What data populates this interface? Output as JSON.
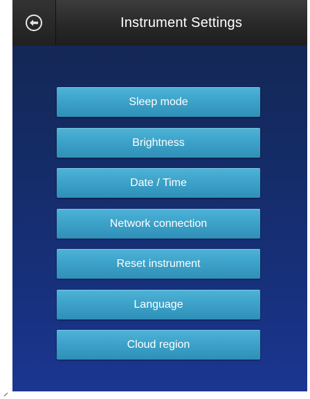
{
  "header": {
    "title": "Instrument Settings",
    "back_icon": "circle-arrow-left-icon"
  },
  "menu": {
    "items": [
      {
        "label": "Sleep mode"
      },
      {
        "label": "Brightness"
      },
      {
        "label": "Date / Time"
      },
      {
        "label": "Network connection"
      },
      {
        "label": "Reset instrument"
      },
      {
        "label": "Language"
      },
      {
        "label": "Cloud region"
      }
    ]
  },
  "colors": {
    "header_bg": "#2a2a2a",
    "screen_bg": "#17307a",
    "button_bg": "#3ca1c8",
    "text": "#ffffff"
  }
}
